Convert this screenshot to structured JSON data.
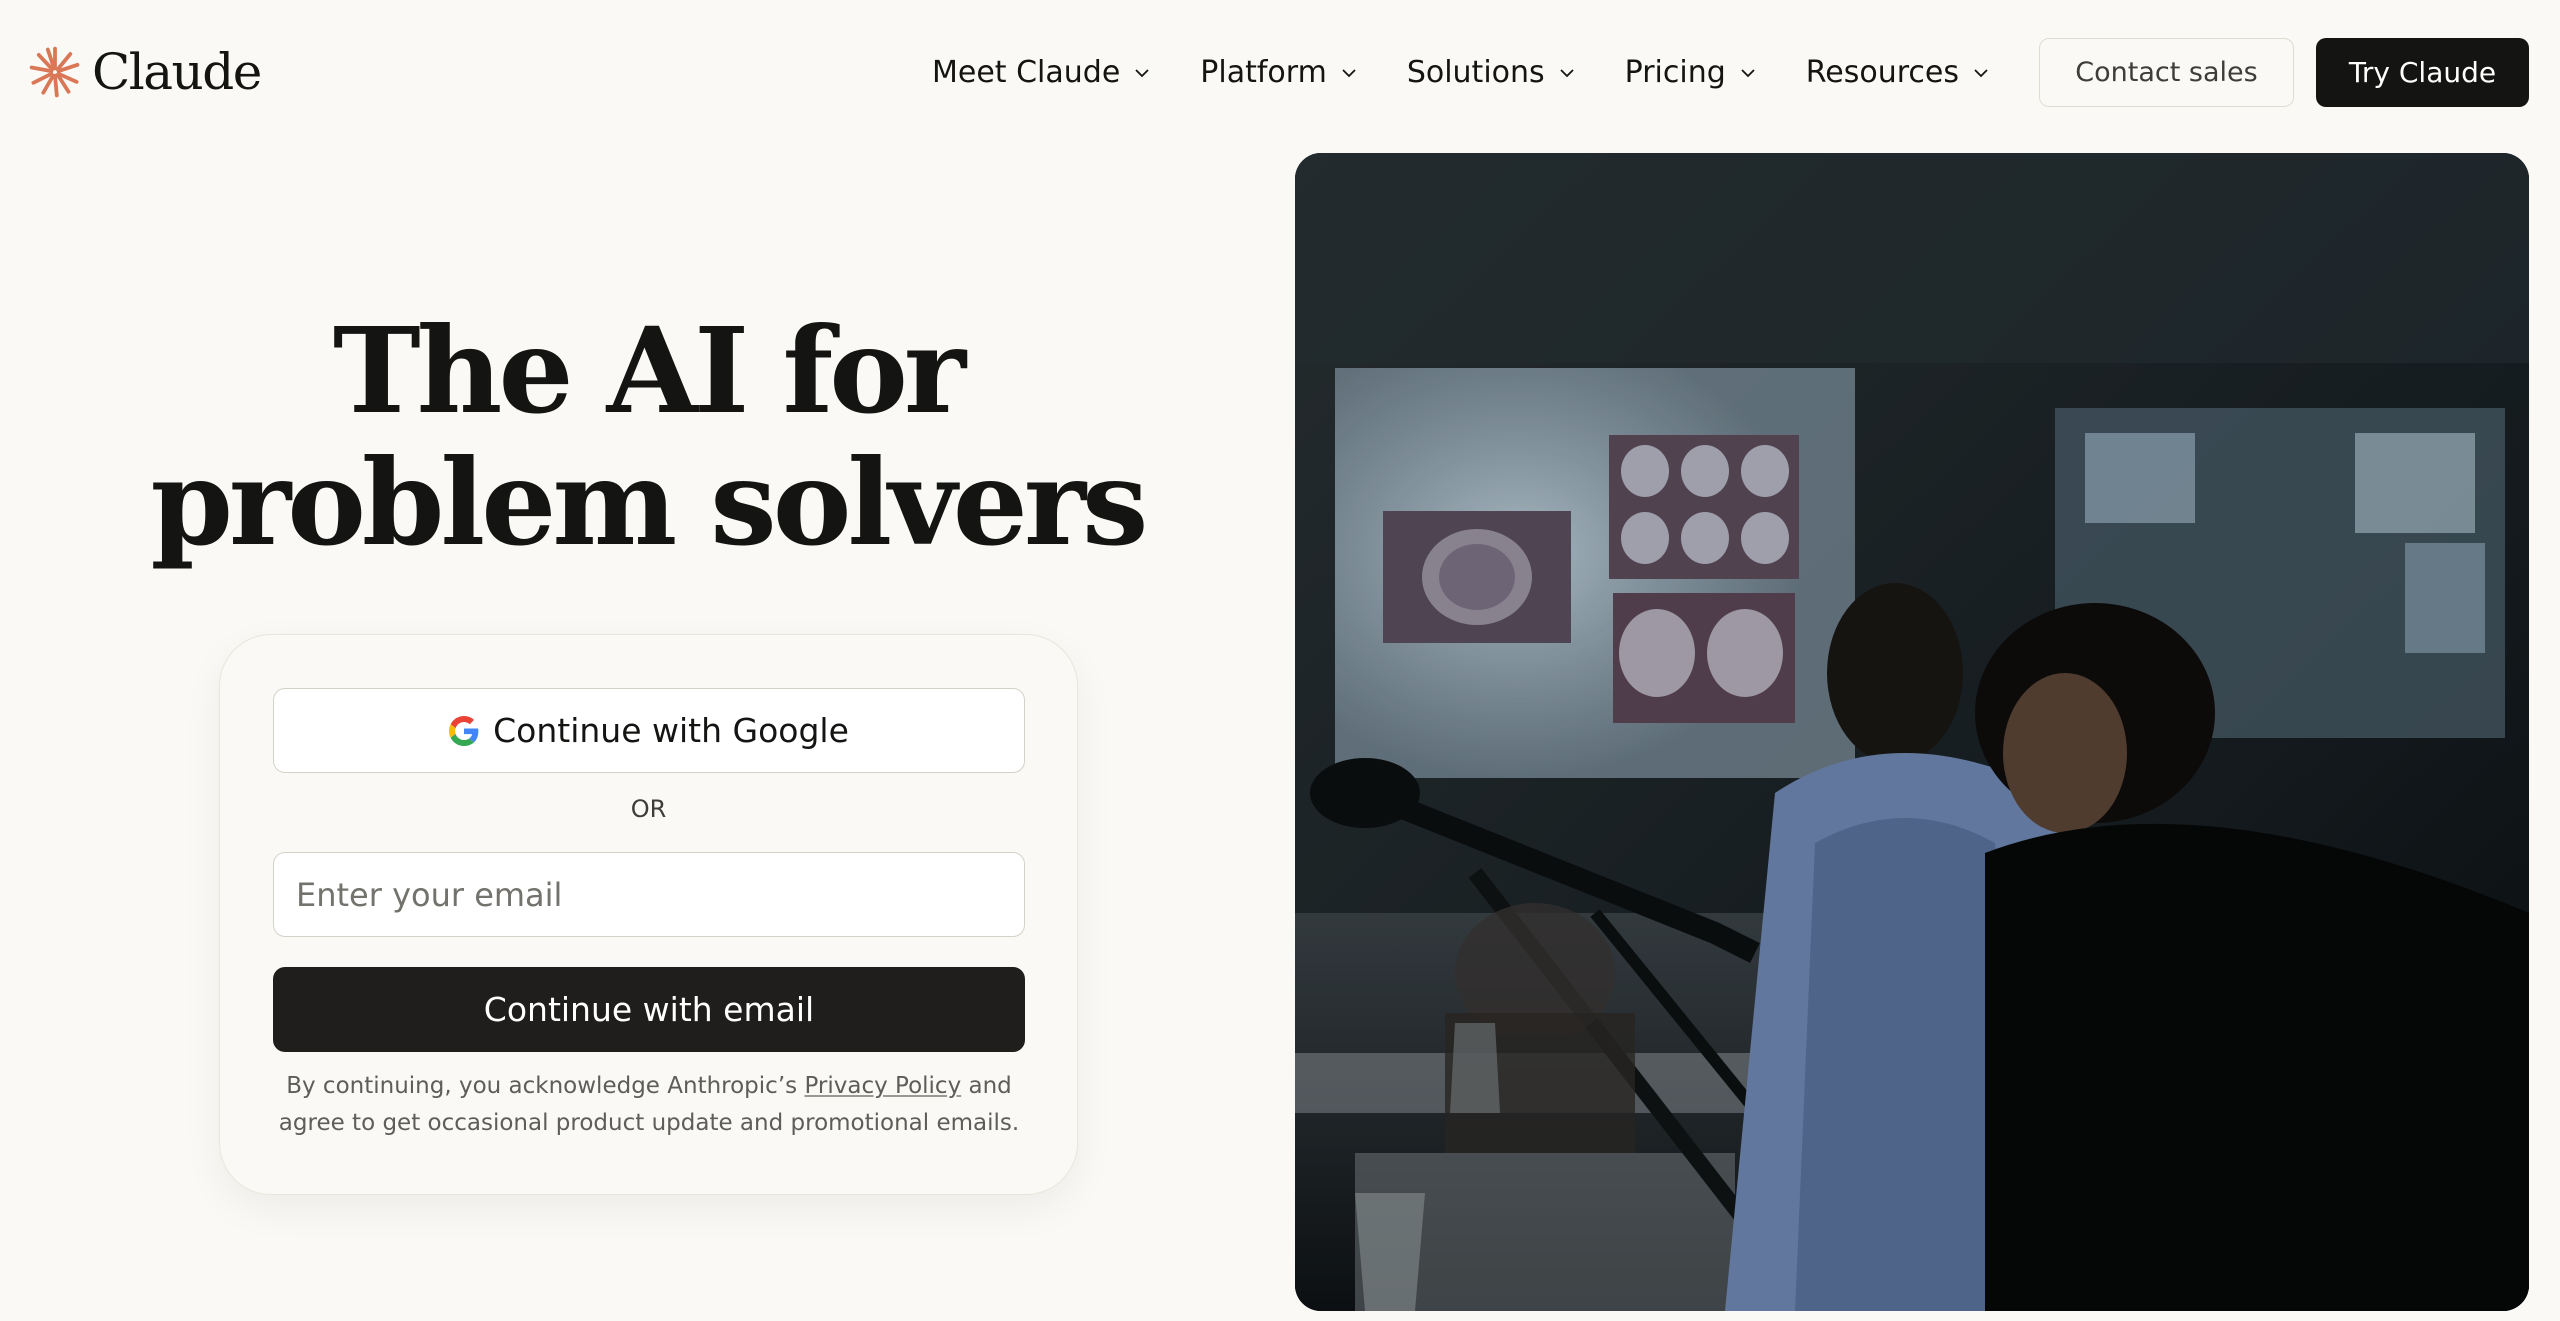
{
  "header": {
    "brand": "Claude",
    "nav": [
      {
        "label": "Meet Claude"
      },
      {
        "label": "Platform"
      },
      {
        "label": "Solutions"
      },
      {
        "label": "Pricing"
      },
      {
        "label": "Resources"
      }
    ],
    "contact_label": "Contact sales",
    "try_label": "Try Claude"
  },
  "hero": {
    "headline_line1": "The AI for",
    "headline_line2": "problem solvers"
  },
  "signup": {
    "google_label": "Continue with Google",
    "or_label": "OR",
    "email_placeholder": "Enter your email",
    "email_button_label": "Continue with email",
    "legal_prefix": "By continuing, you acknowledge Anthropic’s ",
    "privacy_link": "Privacy Policy",
    "legal_suffix": " and agree to get occasional product update and promotional emails."
  },
  "colors": {
    "background": "#faf9f5",
    "brand_accent": "#d97757",
    "primary_button": "#141413"
  },
  "icons": {
    "logo": "claude-starburst-icon",
    "nav_chevron": "chevron-down-icon",
    "google": "google-icon"
  }
}
